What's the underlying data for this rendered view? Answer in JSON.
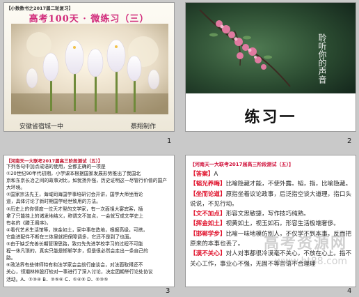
{
  "slides": [
    {
      "number": "1",
      "book_label": "【小数数书之2017届二轮复习】",
      "title": "高考100天 · 微练习（三）",
      "school": "安徽省宿城一中",
      "author": "蔡翔制作"
    },
    {
      "number": "2",
      "main_title": "练习一",
      "photo_vertical_text": "聆听你的声音"
    },
    {
      "number": "3",
      "header": "【河南天一大联考2017届高三阶段测试（五）】",
      "lines": [
        "下列各句中加点成语的使用，全都正确的一项是",
        "①20世纪90年代初期，小学课本根据国家发展形势推出了我国北",
        "京和东京长冶之间的政事对比，如犹扬外强，历史证明这一尽管行价值的国产",
        "大环境。",
        "②国家宗法先王，海域同海国学事培研讨会开讲，国学大师坐而论",
        "道，具体讨论了新时期国学经世致用的方法。",
        "③历史上的你情度一位天才型的文学家，有一次面祖大宴宾客，插",
        "拿了只能挂上的诸发地结义，称谓文不加点，一会就写成文学史上",
        "有名的《滕王阁序》。",
        "④看代艺术生活馆等，抹金如土，家中事在造地，根据高级，可搭，",
        "它能进配件不断在三体里就把保障调多，它还不是到了也面。",
        "⑤由于缺乏完善长期管理思路，致刃先先进学校学习的过程不可能",
        "程一休凡琐的，真实只能是邯郸学步，但是很必然会走出一条自己的",
        "路。",
        "⑥政法界有些律师特有和法学家会会前行座谈会，对法面取得还不",
        "关心，领潮林林股打较对一事进行了深入讨论，决定团期举行论处协议",
        "活动。A．①③④  B．②⑤⑥  C．①④⑤  D．②③⑤"
      ]
    },
    {
      "number": "4",
      "header": "【河南天一大联考2017届高三阶段测试（五）】",
      "answer_label": "【答案】",
      "answer_value": "A",
      "items": [
        {
          "key": "【韬光养晦】",
          "text": "比喻隐藏才能，不使外露。韬，指，比喻隐藏。"
        },
        {
          "key": "【坐而论道】",
          "text": "原指坐着议论政事，后泛指空谈大道理，指口头说说，不见行动。"
        },
        {
          "key": "【文不加点】",
          "text": "形容文思敏捷，写作技巧纯熟。"
        },
        {
          "key": "【挥金如土】",
          "text": "视黄如土，视玉如石。形容生活极端奢侈。"
        },
        {
          "key": "【邯郸学步】",
          "text": "比喻一味地模仿别人，不仅学不到本事，反而把原来的本事也丢了。"
        },
        {
          "key": "【漠不关心】",
          "text": "对人对事都很冷漠毫不关心，不放在心上。指不关心工作，事业心不强，无固不等言语不合理理"
        }
      ],
      "watermark_text": "高考资源网",
      "watermark_url": "www.ht88.com"
    }
  ],
  "colors": {
    "title_pink": "#d12a7a",
    "header_red": "#c0102a",
    "key_red": "#e0102a",
    "link_blue": "#1a4fd0"
  }
}
